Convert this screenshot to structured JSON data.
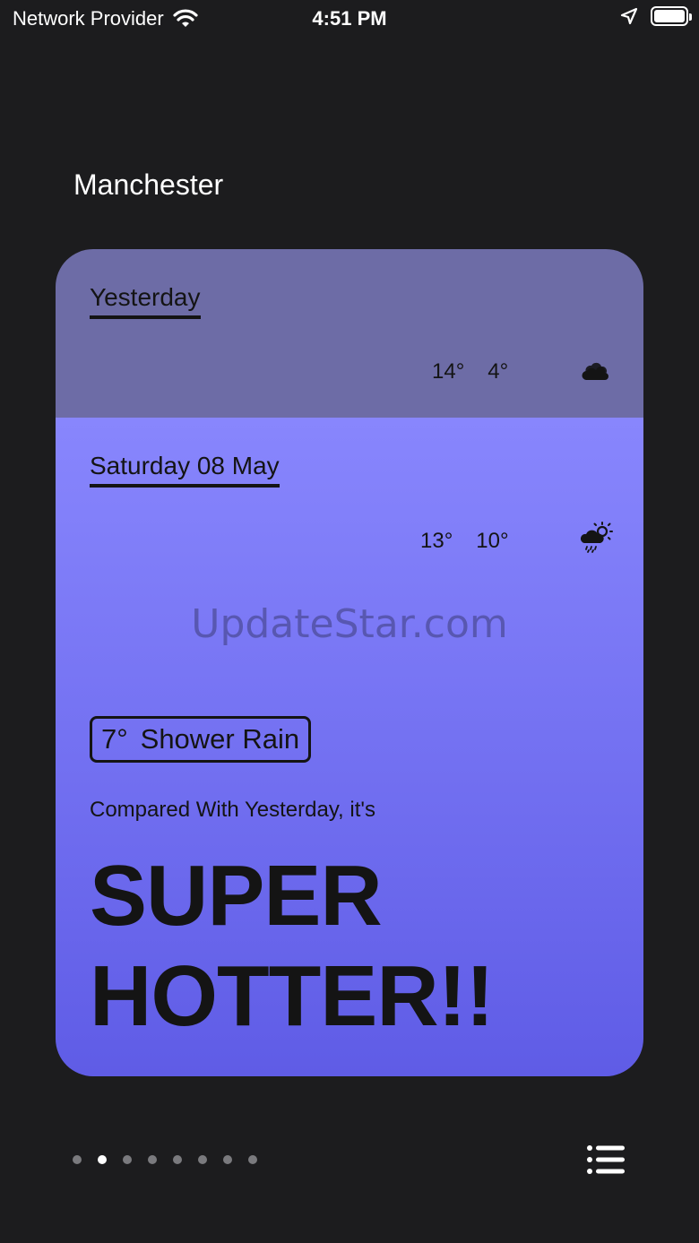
{
  "status_bar": {
    "carrier": "Network Provider",
    "time": "4:51 PM",
    "wifi_icon": "wifi-icon",
    "location_icon": "location-arrow-icon",
    "battery_icon": "battery-full-icon",
    "battery_level": 1.0
  },
  "location": {
    "city": "Manchester"
  },
  "yesterday": {
    "label": "Yesterday",
    "high": "14°",
    "low": "4°",
    "icon": "cloud-icon",
    "background": "#6d6ca6"
  },
  "today": {
    "label": "Saturday 08 May",
    "high": "13°",
    "low": "10°",
    "icon": "partly-sunny-rain-icon",
    "current_temp": "7°",
    "condition": "Shower Rain",
    "compare_text": "Compared With Yesterday, it's",
    "verdict_line1": "SUPER",
    "verdict_line2": "HOTTER!!",
    "gradient_top": "#8886fd",
    "gradient_bottom": "#5f5ce6"
  },
  "watermark": "UpdateStar.com",
  "pager": {
    "count": 8,
    "active_index": 1
  },
  "menu_icon": "list-menu-icon"
}
